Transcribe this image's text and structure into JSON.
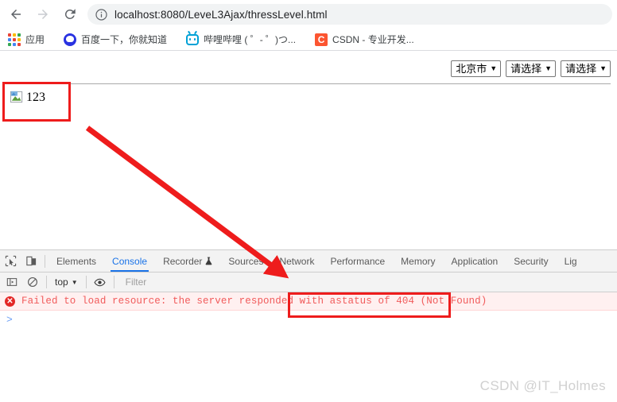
{
  "browser": {
    "nav": {
      "back": {
        "icon": "back-arrow-icon",
        "title": "Back",
        "enabled": true
      },
      "forward": {
        "icon": "forward-arrow-icon",
        "title": "Forward",
        "enabled": false
      },
      "reload": {
        "icon": "reload-icon",
        "title": "Reload"
      }
    },
    "omnibox": {
      "info_icon": "info-circle-icon",
      "url": "localhost:8080/LeveL3Ajax/thressLevel.html"
    },
    "bookmarks": [
      {
        "label": "应用",
        "icon": "apps-grid-icon"
      },
      {
        "label": "百度一下，你就知道",
        "icon": "baidu-icon"
      },
      {
        "label": "哔哩哔哩 ( ゜- ゜)つ...",
        "icon": "bilibili-icon"
      },
      {
        "label": "CSDN - 专业开发...",
        "icon": "csdn-icon"
      }
    ]
  },
  "page": {
    "selects": [
      {
        "value": "北京市",
        "caret": "▼"
      },
      {
        "value": "请选择",
        "caret": "▼"
      },
      {
        "value": "请选择",
        "caret": "▼"
      }
    ],
    "broken_image": {
      "alt": "123",
      "icon": "broken-image-icon"
    }
  },
  "devtools": {
    "left_icons": [
      {
        "name": "inspect-element-icon"
      },
      {
        "name": "device-toolbar-icon"
      }
    ],
    "tabs": [
      {
        "label": "Elements",
        "active": false
      },
      {
        "label": "Console",
        "active": true
      },
      {
        "label": "Recorder",
        "active": false,
        "badge_icon": "flask-icon"
      },
      {
        "label": "Sources",
        "active": false
      },
      {
        "label": "Network",
        "active": false
      },
      {
        "label": "Performance",
        "active": false
      },
      {
        "label": "Memory",
        "active": false
      },
      {
        "label": "Application",
        "active": false
      },
      {
        "label": "Security",
        "active": false
      },
      {
        "label": "Lig",
        "active": false
      }
    ],
    "console_toolbar": {
      "sidebar_icon": "console-sidebar-icon",
      "clear_icon": "clear-console-icon",
      "context": "top",
      "context_caret": "▼",
      "eye_icon": "live-expression-eye-icon",
      "filter_placeholder": "Filter"
    },
    "console_messages": [
      {
        "level": "error",
        "badge": "✕",
        "text_before": "Failed to load resource: the server responded with a ",
        "text_highlight": "status of 404 (Not Found)"
      }
    ],
    "prompt": ">"
  },
  "annotations": {
    "color": "#ee1c1c",
    "image_box": {
      "name": "broken-image-highlight"
    },
    "error_box": {
      "name": "status-404-highlight"
    },
    "arrow": {
      "name": "pointer-arrow",
      "from": "broken image",
      "to": "console error"
    }
  },
  "watermark": {
    "text": "CSDN @IT_Holmes"
  }
}
